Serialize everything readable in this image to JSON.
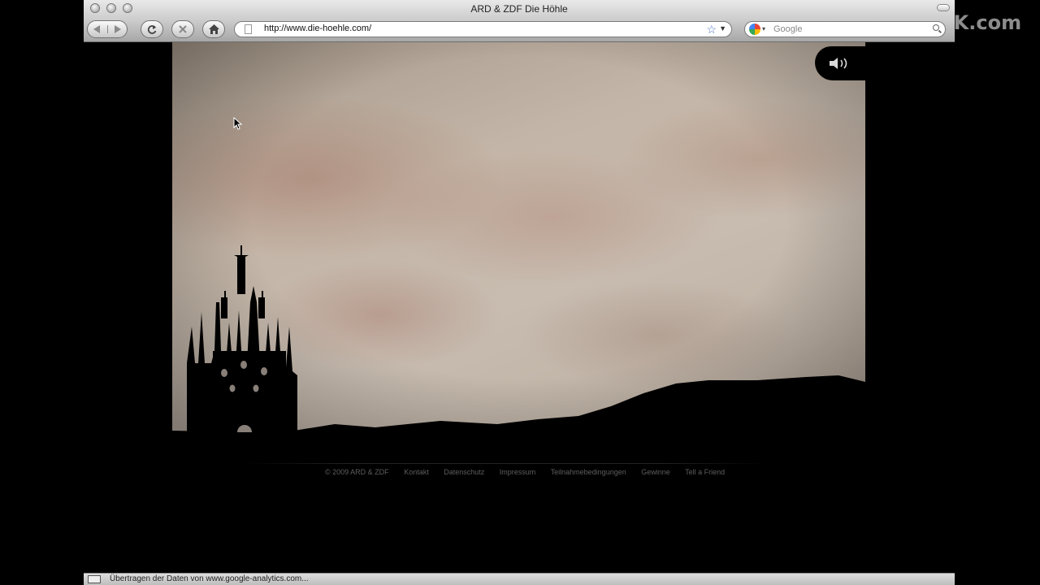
{
  "watermark": "TVCBOOK.com",
  "window": {
    "title": "ARD & ZDF Die Höhle"
  },
  "toolbar": {
    "back_icon": "back-arrow-icon",
    "forward_icon": "forward-arrow-icon",
    "reload_icon": "reload-icon",
    "stop_icon": "stop-icon",
    "home_icon": "home-icon",
    "url": "http://www.die-hoehle.com/",
    "search_placeholder": "Google"
  },
  "page": {
    "sound_icon": "speaker-icon",
    "footer": {
      "copyright": "© 2009 ARD & ZDF",
      "links": [
        "Kontakt",
        "Datenschutz",
        "Impressum",
        "Teilnahmebedingungen",
        "Gewinne",
        "Tell a Friend"
      ]
    }
  },
  "statusbar": {
    "text": "Übertragen der Daten von www.google-analytics.com..."
  }
}
